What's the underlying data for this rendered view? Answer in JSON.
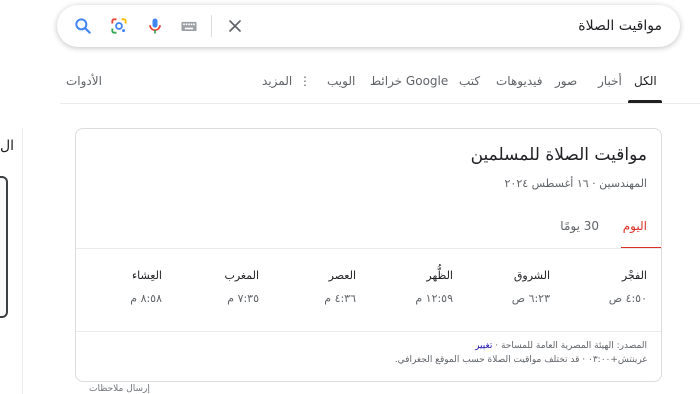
{
  "search": {
    "query": "مواقيت الصلاة",
    "placeholder": ""
  },
  "icons": {
    "search": "search-icon",
    "lens": "google-lens-icon",
    "mic": "microphone-icon",
    "keyboard": "keyboard-icon",
    "clear": "close-icon",
    "more": "vertical-dots-icon"
  },
  "tabs": {
    "all": "الكل",
    "news": "أخبار",
    "images": "صور",
    "videos": "فيديوهات",
    "books": "كتب",
    "maps": "خرائط Google",
    "web": "الويب",
    "more": "المزيد",
    "tools": "الأدوات"
  },
  "left_edge": {
    "text": "ال"
  },
  "card": {
    "title": "مواقيت الصلاة للمسلمين",
    "subtitle": "المهندسين · ١٦ أغسطس ٢٠٢٤",
    "tab_today": "اليوم",
    "tab_30": "30 يومًا",
    "times": [
      {
        "name": "الفجْر",
        "value": "٤:٥٠ ص"
      },
      {
        "name": "الشروق",
        "value": "٦:٢٣ ص"
      },
      {
        "name": "الظُّهر",
        "value": "١٢:٥٩ م"
      },
      {
        "name": "العصر",
        "value": "٤:٣٦ م"
      },
      {
        "name": "المغرب",
        "value": "٧:٣٥ م"
      },
      {
        "name": "العِشاء",
        "value": "٨:٥٨ م"
      }
    ],
    "source_prefix": "المصدر: الهيئة المصرية العامة للمساحة ·",
    "source_link": "تغيير",
    "note": "غرينتش+٠٣:٠٠ · قد تختلف مواقيت الصلاة حسب الموقع الجغرافي."
  },
  "feedback": "إرسال ملاحظات",
  "colors": {
    "accent_red": "#d93025",
    "link": "#1a0dab",
    "mic_blue": "#4285f4"
  }
}
